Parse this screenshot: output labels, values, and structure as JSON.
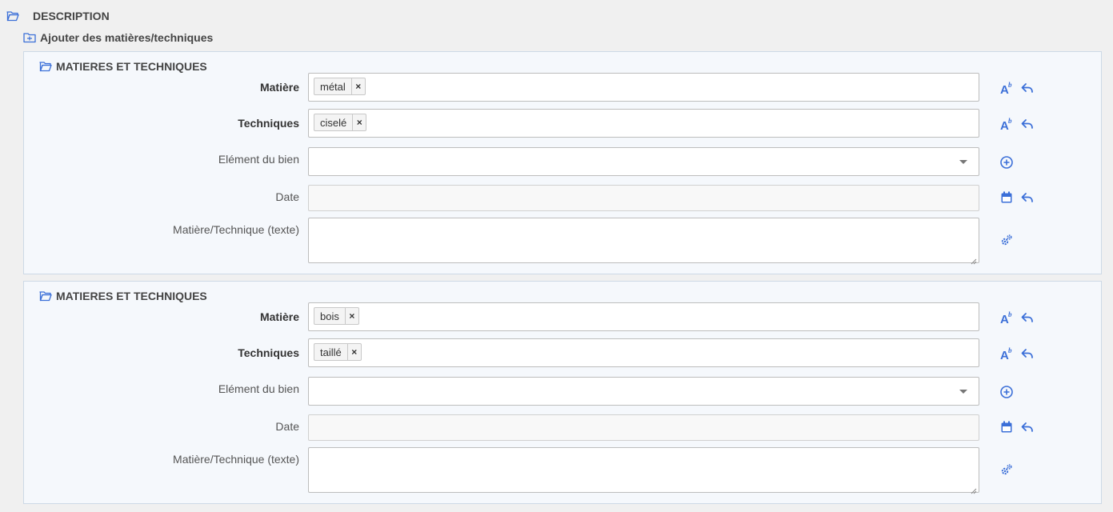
{
  "section": {
    "title": "DESCRIPTION",
    "add_label": "Ajouter des matières/techniques"
  },
  "colors": {
    "accent": "#3b6fd8",
    "panel_bg": "#f5f8fc",
    "panel_border": "#cdd9e6"
  },
  "panels": [
    {
      "title": "MATIERES ET TECHNIQUES",
      "matiere": {
        "label": "Matière",
        "tag": "métal",
        "remove": "×"
      },
      "techniques": {
        "label": "Techniques",
        "tag": "ciselé",
        "remove": "×"
      },
      "element": {
        "label": "Elément du bien",
        "value": ""
      },
      "date": {
        "label": "Date",
        "value": ""
      },
      "texte": {
        "label": "Matière/Technique (texte)",
        "value": ""
      }
    },
    {
      "title": "MATIERES ET TECHNIQUES",
      "matiere": {
        "label": "Matière",
        "tag": "bois",
        "remove": "×"
      },
      "techniques": {
        "label": "Techniques",
        "tag": "taillé",
        "remove": "×"
      },
      "element": {
        "label": "Elément du bien",
        "value": ""
      },
      "date": {
        "label": "Date",
        "value": ""
      },
      "texte": {
        "label": "Matière/Technique (texte)",
        "value": ""
      }
    }
  ],
  "icons": {
    "folder": "folder-open-icon",
    "add_folder": "folder-add-icon",
    "spellcheck": "font-style-icon",
    "undo": "reply-icon",
    "add": "plus-circle-icon",
    "calendar": "calendar-icon",
    "settings": "gears-icon"
  }
}
